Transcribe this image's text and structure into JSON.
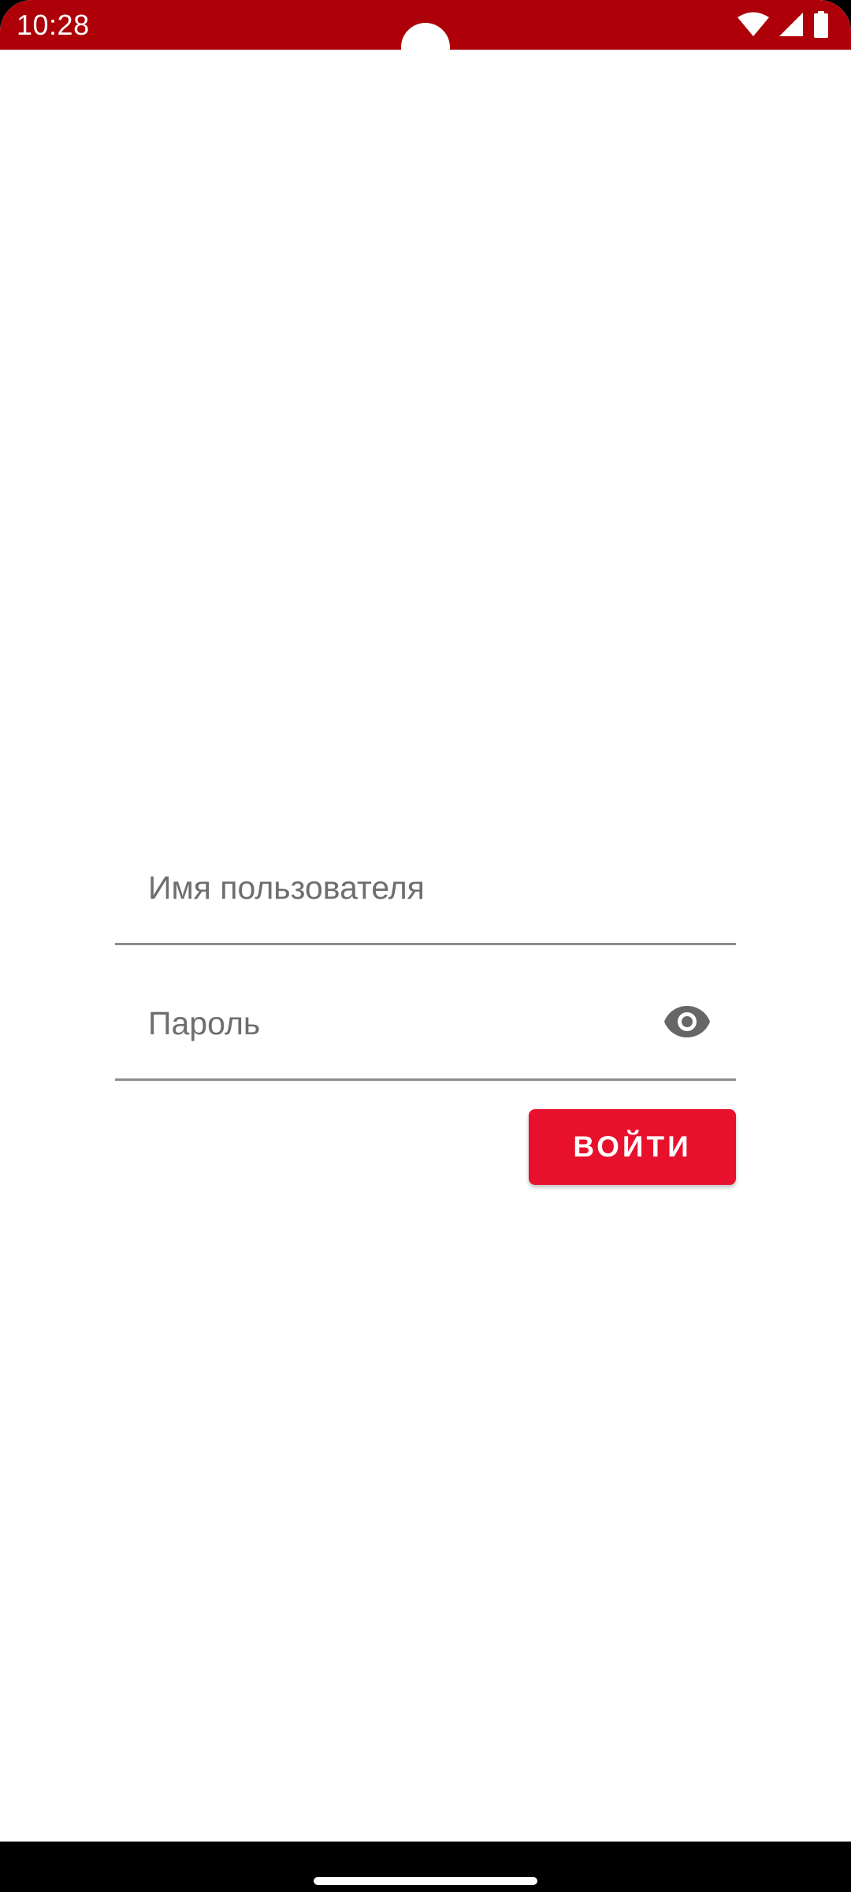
{
  "status_bar": {
    "time": "10:28",
    "background_color": "#ad0008",
    "icons": [
      "wifi-icon",
      "cellular-signal-icon",
      "battery-icon"
    ]
  },
  "login_form": {
    "username_placeholder": "Имя пользователя",
    "password_placeholder": "Пароль",
    "password_visibility_icon": "eye-icon",
    "login_button_label": "ВОЙТИ",
    "accent_color": "#e8112d"
  },
  "navigation_bar": {
    "handle": "home-gesture-handle"
  }
}
